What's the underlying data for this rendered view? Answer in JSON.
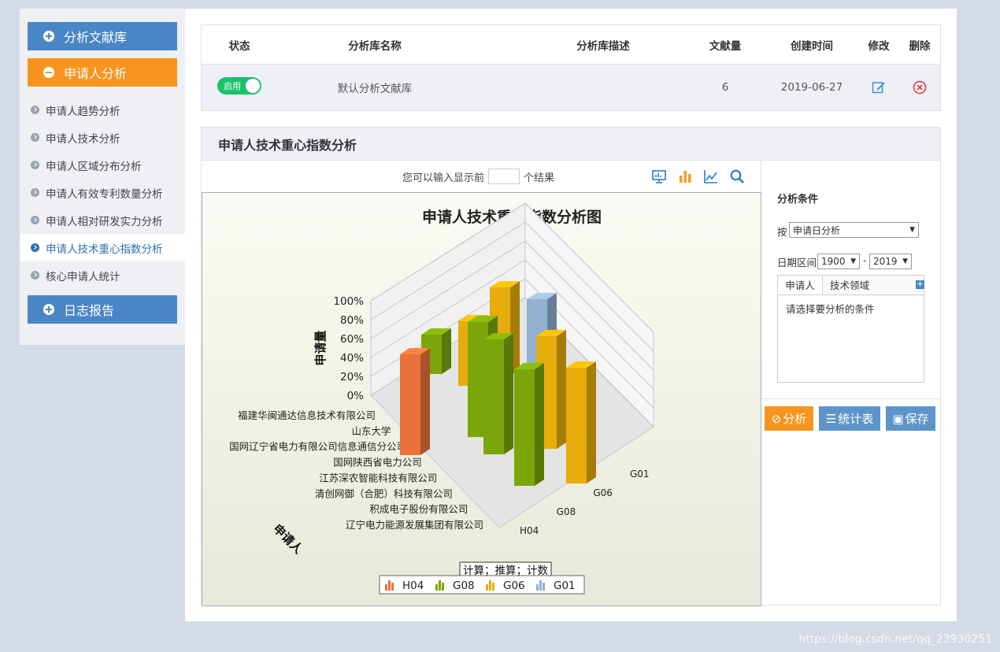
{
  "sidebar": {
    "btn_library": "分析文献库",
    "btn_applicant": "申请人分析",
    "items": [
      {
        "label": "申请人趋势分析"
      },
      {
        "label": "申请人技术分析"
      },
      {
        "label": "申请人区域分布分析"
      },
      {
        "label": "申请人有效专利数量分析"
      },
      {
        "label": "申请人相对研发实力分析"
      },
      {
        "label": "申请人技术重心指数分析"
      },
      {
        "label": "核心申请人统计"
      }
    ],
    "btn_log": "日志报告"
  },
  "library_table": {
    "headers": [
      "状态",
      "分析库名称",
      "分析库描述",
      "文献量",
      "创建时间",
      "修改",
      "删除"
    ],
    "row": {
      "status": "启用",
      "name": "默认分析文献库",
      "desc": "",
      "count": "6",
      "created": "2019-06-27"
    }
  },
  "panel": {
    "title": "申请人技术重心指数分析",
    "topn_prefix": "您可以输入显示前",
    "topn_suffix": "个结果"
  },
  "chart_data": {
    "type": "bar",
    "subtype": "3d-column",
    "title": "申请人技术重心指数分析图",
    "ylabel": "申请量",
    "xlabel": "申请人",
    "yticks": [
      "100%",
      "80%",
      "60%",
      "40%",
      "20%",
      "0%"
    ],
    "ylim": [
      0,
      100
    ],
    "categories": [
      "辽宁电力能源发展集团有限公司",
      "积成电子股份有限公司",
      "清创网御（合肥）科技有限公司",
      "江苏深农智能科技有限公司",
      "国网陕西省电力公司",
      "国网辽宁省电力有限公司信息通信分公司",
      "山东大学",
      "福建华闽通达信息技术有限公司"
    ],
    "depth_categories": [
      "H04",
      "G08",
      "G06",
      "G01"
    ],
    "legend": [
      "H04",
      "G08",
      "G06",
      "G01"
    ],
    "legend_position": "bottom",
    "annotation": "计算；推算；计数",
    "colors": {
      "H04": "#e8723a",
      "G08": "#7aa60a",
      "G06": "#e6ac0c",
      "G01": "#92b1cf"
    }
  },
  "conditions": {
    "title": "分析条件",
    "by_label": "按",
    "by_value": "申请日分析",
    "range_label": "日期区间",
    "from_year": "1900",
    "to_year": "2019",
    "dash": "-",
    "tab_applicant": "申请人",
    "tab_tech": "技术领域",
    "placeholder": "请选择要分析的条件",
    "btn_analyze": "分析",
    "btn_stats": "统计表",
    "btn_save": "保存"
  },
  "watermark": "https://blog.csdn.net/qq_23930251"
}
